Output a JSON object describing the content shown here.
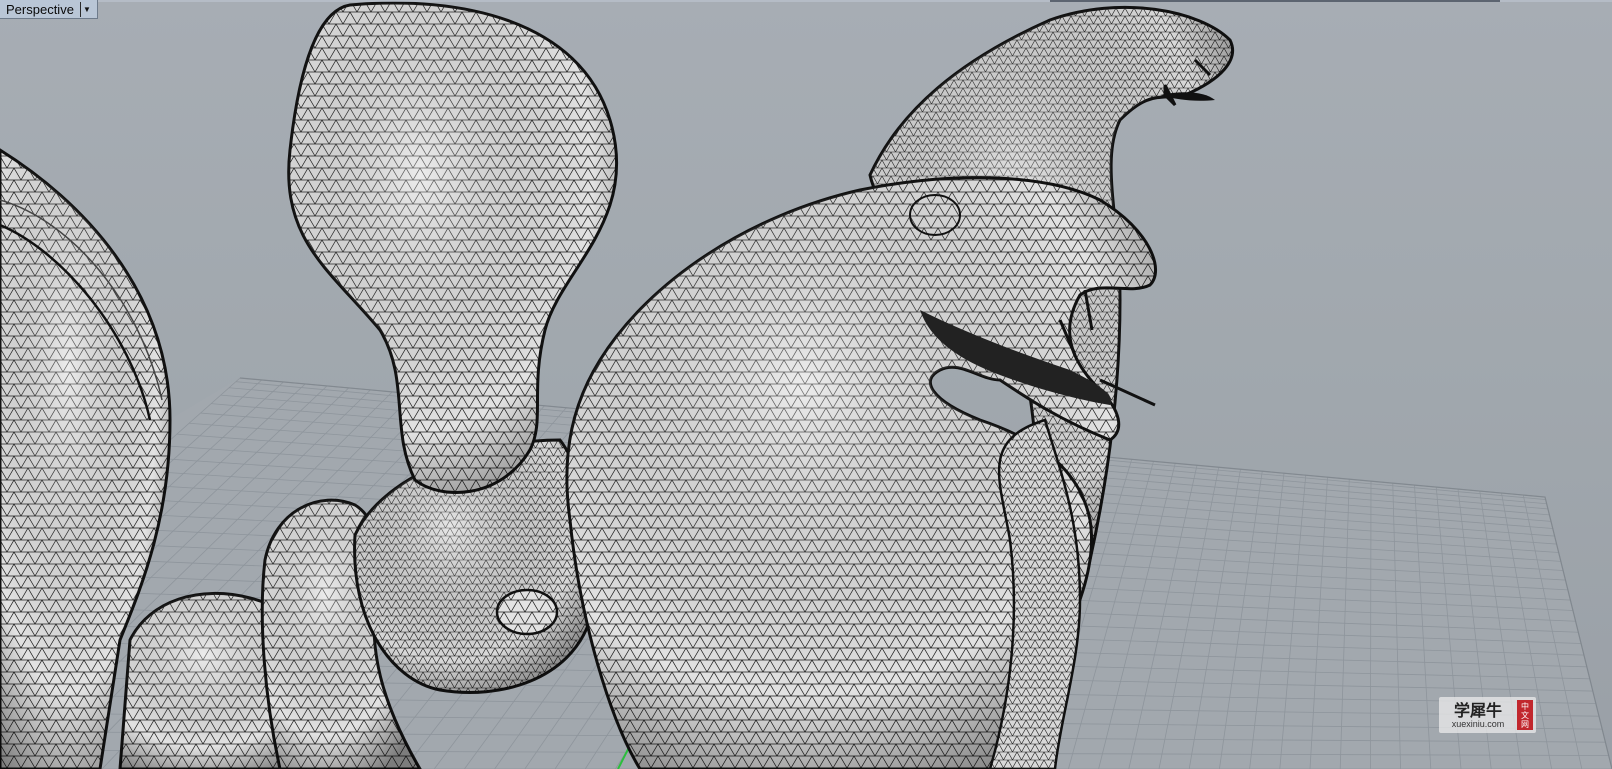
{
  "viewport": {
    "name": "Perspective",
    "dropdown_icon": "triangle-down-icon"
  },
  "scene": {
    "background_color": "#a1a8ae",
    "grid_color": "#8d949b",
    "mesh_fill": "#e6e6e6",
    "mesh_line": "#1a1a1a",
    "x_axis_color": "#2bbf3c"
  },
  "watermark": {
    "title": "学犀牛",
    "url": "xuexiniu.com",
    "seal": [
      "中",
      "文",
      "网"
    ]
  }
}
